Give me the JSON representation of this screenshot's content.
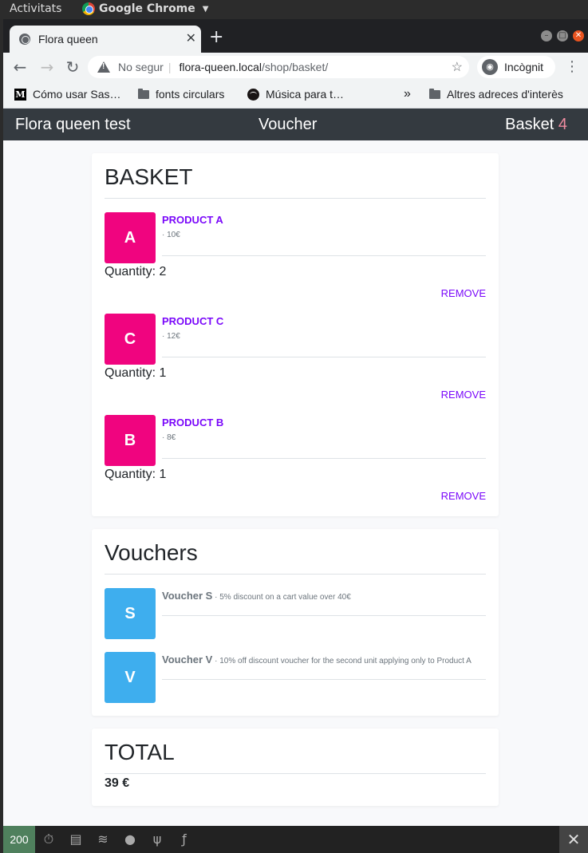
{
  "os": {
    "activities": "Activitats",
    "app_name": "Google Chrome"
  },
  "browser": {
    "tab_title": "Flora queen",
    "url_warning": "No segur",
    "url_host": "flora-queen.local",
    "url_path": "/shop/basket/",
    "incognito_label": "Incògnit",
    "bookmarks": [
      {
        "label": "Cómo usar Sas…",
        "icon": "medium-icon"
      },
      {
        "label": "fonts circulars",
        "icon": "folder-icon"
      },
      {
        "label": "Música para t…",
        "icon": "spotify-icon"
      },
      {
        "label": "Altres adreces d'interès",
        "icon": "folder-icon"
      }
    ],
    "overflow": "»"
  },
  "nav": {
    "brand": "Flora queen test",
    "voucher": "Voucher",
    "basket": "Basket",
    "basket_count": "4"
  },
  "basket": {
    "title": "BASKET",
    "items": [
      {
        "letter": "A",
        "name": "PRODUCT A",
        "price": "· 10€",
        "quantity": "Quantity: 2",
        "remove": "REMOVE"
      },
      {
        "letter": "C",
        "name": "PRODUCT C",
        "price": "· 12€",
        "quantity": "Quantity: 1",
        "remove": "REMOVE"
      },
      {
        "letter": "B",
        "name": "PRODUCT B",
        "price": "· 8€",
        "quantity": "Quantity: 1",
        "remove": "REMOVE"
      }
    ]
  },
  "vouchers": {
    "title": "Vouchers",
    "items": [
      {
        "letter": "S",
        "name": "Voucher S",
        "desc": "· 5% discount on a cart value over 40€"
      },
      {
        "letter": "V",
        "name": "Voucher V",
        "desc": "· 10% off discount voucher for the second unit applying only to Product A"
      }
    ]
  },
  "total": {
    "title": "TOTAL",
    "value": "39 €"
  },
  "debug_bar": {
    "status": "200"
  },
  "colors": {
    "product_thumb": "#f0047f",
    "voucher_thumb": "#3eaeee",
    "accent": "#7a08fa",
    "navbar": "#343a40"
  }
}
